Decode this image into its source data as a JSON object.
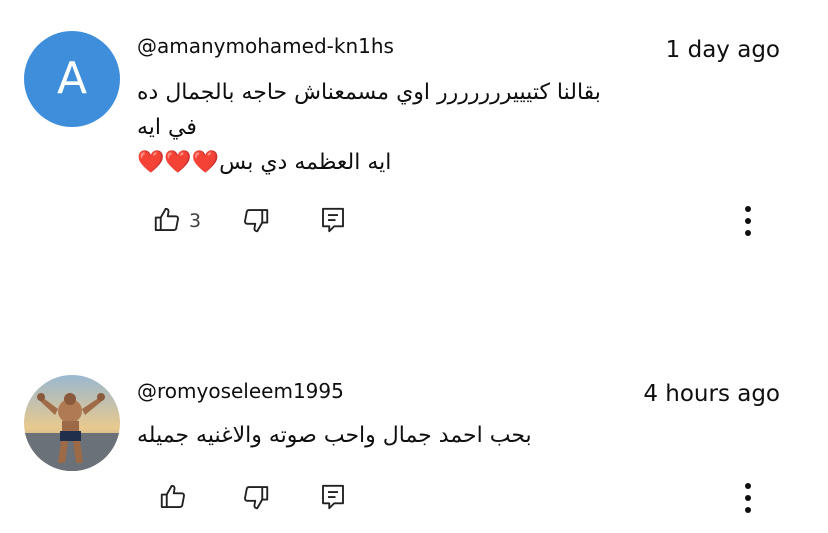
{
  "comments": [
    {
      "avatar_letter": "A",
      "avatar_color": "#3f8edc",
      "handle": "@amanymohamed-kn1hs",
      "time": "1 day ago",
      "lines": [
        "بقالنا كتيييررررررر اوي مسمعناش حاجه بالجمال ده",
        "في ايه",
        "ايه العظمه دي بس❤️❤️❤️"
      ],
      "like_count": "3"
    },
    {
      "avatar_description_icon": "bodybuilder-photo-avatar",
      "handle": "@romyoseleem1995",
      "time": "4 hours ago",
      "lines": [
        "بحب احمد جمال واحب صوته والاغنيه جميله"
      ],
      "like_count": ""
    }
  ],
  "icons": {
    "like": "thumbs-up-icon",
    "dislike": "thumbs-down-icon",
    "reply": "reply-icon",
    "more": "more-vertical-icon"
  }
}
